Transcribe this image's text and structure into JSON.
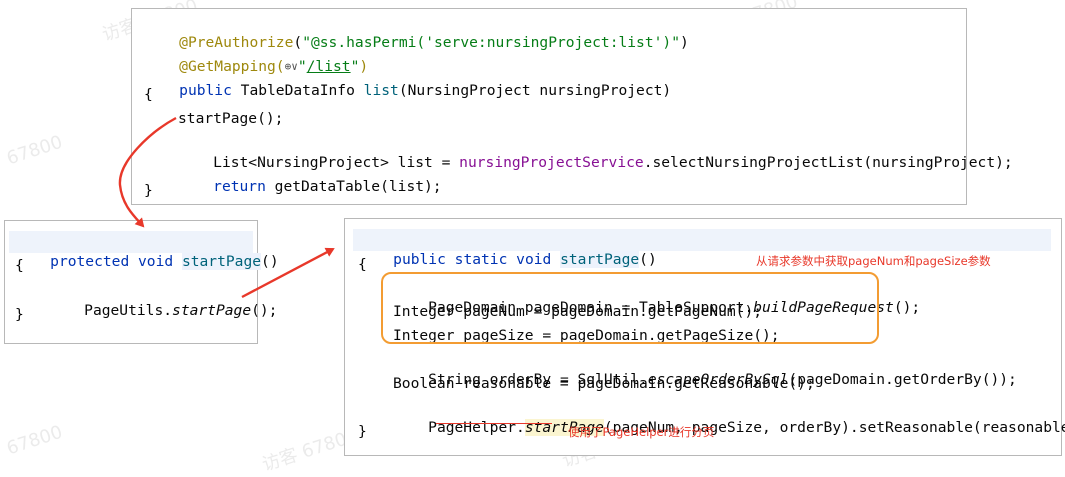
{
  "top_panel": {
    "annotation1": "@PreAuthorize",
    "annotation1_args_prefix": "(",
    "annotation1_string": "\"@ss.hasPermi('serve:nursingProject:list')\"",
    "annotation1_args_suffix": ")",
    "annotation2": "@GetMapping(",
    "globe_icon": "⊕∨",
    "annotation2_quote_open": "\"",
    "annotation2_url": "/list",
    "annotation2_quote_close": "\"",
    "annotation2_close": ")",
    "sig_kw": "public",
    "sig_type": " TableDataInfo ",
    "sig_name": "list",
    "sig_params": "(NursingProject nursingProject)",
    "open_brace": "{",
    "stmt1": "startPage();",
    "stmt2_prefix": "List<NursingProject> list = ",
    "stmt2_field": "nursingProjectService",
    "stmt2_suffix": ".selectNursingProjectList(nursingProject);",
    "stmt3_kw": "return",
    "stmt3_rest": " getDataTable(list);",
    "close_brace": "}"
  },
  "left_panel": {
    "sig_kw": "protected void ",
    "sig_name": "startPage",
    "sig_rest": "()",
    "open_brace": "{",
    "stmt_prefix": "PageUtils.",
    "stmt_call": "startPage",
    "stmt_suffix": "();",
    "close_brace": "}"
  },
  "right_panel": {
    "sig_kw": "public static void ",
    "sig_name": "startPage",
    "sig_rest": "()",
    "open_brace": "{",
    "l1_prefix": "PageDomain pageDomain = TableSupport.",
    "l1_call": "buildPageRequest",
    "l1_suffix": "();",
    "l2": "Integer pageNum = pageDomain.getPageNum();",
    "l3": "Integer pageSize = pageDomain.getPageSize();",
    "l4_prefix": "String orderBy = SqlUtil.",
    "l4_call": "escapeOrderBySql",
    "l4_suffix": "(pageDomain.getOrderBy());",
    "l5": "Boolean reasonable = pageDomain.getReasonable();",
    "l6_prefix": "PageHelper.",
    "l6_call": "startPage",
    "l6_suffix": "(pageNum, pageSize, orderBy).setReasonable(reasonable);",
    "close_brace": "}"
  },
  "notes": {
    "params_note": "从请求参数中获取pageNum和pageSize参数",
    "helper_note": "使用了PageHelper进行分页"
  },
  "watermarks": [
    "访客 67800",
    "访客 67800",
    "67800",
    "访客 67800",
    "访客 67800",
    "67800",
    "访客 67800",
    "访客 67800",
    "访客 67800"
  ],
  "colors": {
    "annotation": "#9e880d",
    "string": "#067d17",
    "keyword": "#0033b3",
    "method": "#00627a",
    "field": "#871094",
    "arrow_red": "#e8382a",
    "orange_box": "#f39c32"
  }
}
